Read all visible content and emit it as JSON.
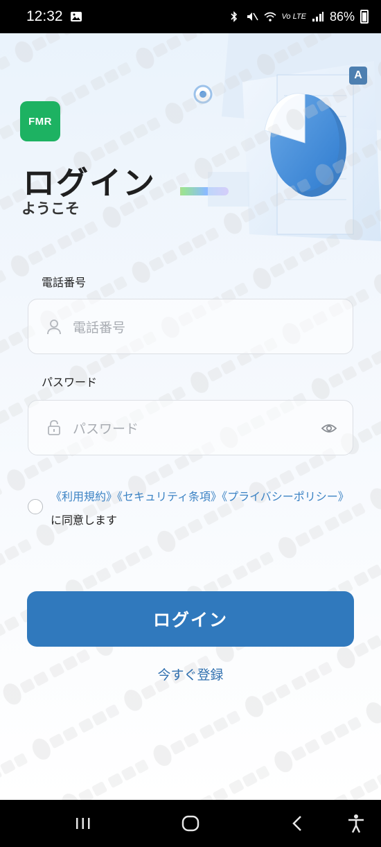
{
  "status_bar": {
    "time": "12:32",
    "carrier_tag": "Vo LTE",
    "battery": "86%"
  },
  "app": {
    "logo_text": "FMR",
    "a_badge": "A",
    "title": "ログイン",
    "subtitle": "ようこそ"
  },
  "form": {
    "phone_label": "電話番号",
    "phone_placeholder": "電話番号",
    "password_label": "パスワード",
    "password_placeholder": "パスワード"
  },
  "terms": {
    "link1": "《利用規約》",
    "link2": "《セキュリティ条項》",
    "link3": "《プライバシーポリシー》",
    "suffix": "に同意します",
    "checked": false
  },
  "actions": {
    "login_label": "ログイン",
    "register_label": "今すぐ登録"
  },
  "colors": {
    "primary": "#3079bd",
    "link": "#3b82c4",
    "logo_green": "#1db262"
  }
}
